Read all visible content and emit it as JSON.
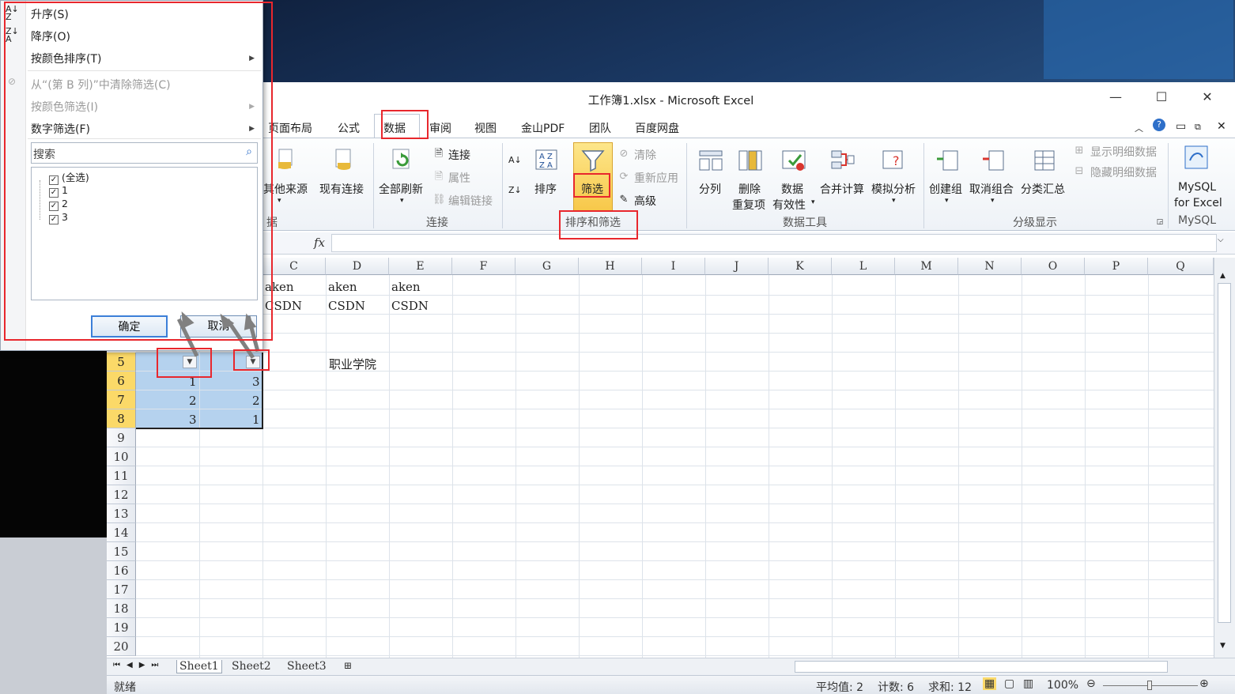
{
  "window": {
    "title": "工作簿1.xlsx - Microsoft Excel",
    "controls": {
      "minimize": "—",
      "maximize": "☐",
      "close": "✕"
    }
  },
  "tabs": [
    "页面布局",
    "公式",
    "数据",
    "审阅",
    "视图",
    "金山PDF",
    "团队",
    "百度网盘"
  ],
  "active_tab": "数据",
  "ribbon": {
    "get_external": {
      "other_sources": "其他来源",
      "existing_conn": "现有连接",
      "group_partial": "据"
    },
    "connections": {
      "refresh_all": "全部刷新",
      "connections": "连接",
      "properties": "属性",
      "edit_links": "编辑链接",
      "group": "连接"
    },
    "sort_filter": {
      "sort": "排序",
      "filter": "筛选",
      "clear": "清除",
      "reapply": "重新应用",
      "advanced": "高级",
      "group": "排序和筛选"
    },
    "data_tools": {
      "text_to_columns": "分列",
      "remove_dup_1": "删除",
      "remove_dup_2": "重复项",
      "validation_1": "数据",
      "validation_2": "有效性",
      "consolidate": "合并计算",
      "what_if": "模拟分析",
      "group": "数据工具"
    },
    "outline": {
      "group_btn": "创建组",
      "ungroup": "取消组合",
      "subtotal": "分类汇总",
      "show_detail": "显示明细数据",
      "hide_detail": "隐藏明细数据",
      "group": "分级显示"
    },
    "mysql": {
      "line1": "MySQL",
      "line2": "for Excel",
      "group": "MySQL"
    }
  },
  "formula_bar": {
    "fx": "fx",
    "value": ""
  },
  "columns": [
    "C",
    "D",
    "E",
    "F",
    "G",
    "H",
    "I",
    "J",
    "K",
    "L",
    "M",
    "N",
    "O",
    "P",
    "Q"
  ],
  "rows": [
    "5",
    "6",
    "7",
    "8",
    "9",
    "10",
    "11",
    "12",
    "13",
    "14",
    "15",
    "16",
    "17",
    "18",
    "19",
    "20"
  ],
  "cells": {
    "c1": "aken",
    "d1": "aken",
    "e1": "aken",
    "c2": "CSDN",
    "d2": "CSDN",
    "e2": "CSDN",
    "d5": "职业学院",
    "a6": "1",
    "b6": "3",
    "a7": "2",
    "b7": "2",
    "a8": "3",
    "b8": "1"
  },
  "sheets": [
    "Sheet1",
    "Sheet2",
    "Sheet3"
  ],
  "status": {
    "ready": "就绪",
    "average": "平均值: 2",
    "count": "计数: 6",
    "sum": "求和: 12",
    "zoom": "100%"
  },
  "filter_menu": {
    "sort_asc": "升序(S)",
    "sort_desc": "降序(O)",
    "sort_by_color": "按颜色排序(T)",
    "clear_filter": "从“(第 B 列)”中清除筛选(C)",
    "filter_by_color": "按颜色筛选(I)",
    "number_filter": "数字筛选(F)",
    "search_placeholder": "搜索",
    "items": [
      "(全选)",
      "1",
      "2",
      "3"
    ],
    "ok": "确定",
    "cancel": "取消"
  },
  "colors": {
    "highlight": "#e8272d",
    "selection": "#b5d2ee",
    "row_header_selected": "#fbd968",
    "filter_active": "#fbd968"
  }
}
